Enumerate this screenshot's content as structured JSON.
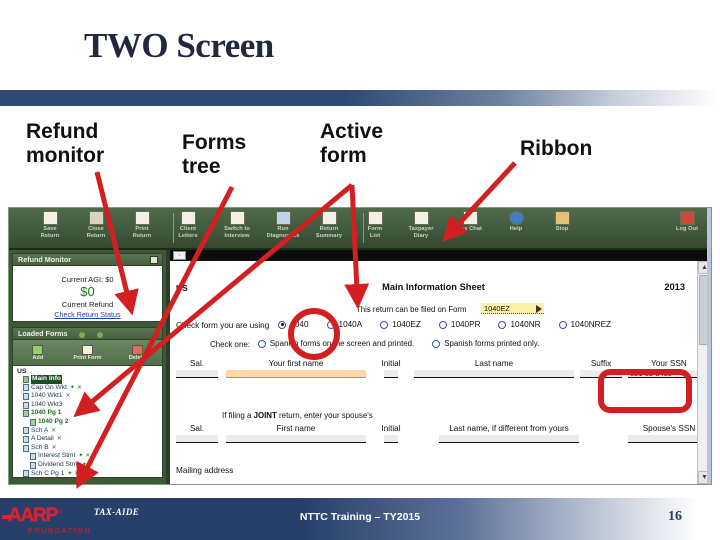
{
  "slide": {
    "title": "TWO Screen",
    "page_number": "16"
  },
  "callouts": [
    {
      "id": "refund-monitor",
      "label": "Refund\nmonitor"
    },
    {
      "id": "forms-tree",
      "label": "Forms\ntree"
    },
    {
      "id": "active-form",
      "label": "Active\nform"
    },
    {
      "id": "ribbon",
      "label": "Ribbon"
    }
  ],
  "callout_text": {
    "refund_monitor_l1": "Refund",
    "refund_monitor_l2": "monitor",
    "forms_tree_l1": "Forms",
    "forms_tree_l2": "tree",
    "active_form_l1": "Active",
    "active_form_l2": "form",
    "ribbon": "Ribbon"
  },
  "app": {
    "ribbon": {
      "items": [
        {
          "label_l1": "Save",
          "label_l2": "Return",
          "icon": "save-icon"
        },
        {
          "label_l1": "Close",
          "label_l2": "Return",
          "icon": "close-folder-icon"
        },
        {
          "label_l1": "Print",
          "label_l2": "Return",
          "icon": "printer-icon"
        },
        {
          "label_l1": "Client",
          "label_l2": "Letters",
          "icon": "envelope-icon"
        },
        {
          "label_l1": "Switch to",
          "label_l2": "Interview",
          "icon": "document-note-icon"
        },
        {
          "label_l1": "Run",
          "label_l2": "Diagnostics",
          "icon": "diagnostics-icon"
        },
        {
          "label_l1": "Return",
          "label_l2": "Summary",
          "icon": "summary-page-icon"
        },
        {
          "label_l1": "Form",
          "label_l2": "List",
          "icon": "list-icon"
        },
        {
          "label_l1": "Taxpayer",
          "label_l2": "Diary",
          "icon": "diary-icon"
        },
        {
          "label_l1": "Tax Chat",
          "label_l2": "",
          "icon": "chat-icon"
        },
        {
          "label_l1": "Help",
          "label_l2": "",
          "icon": "help-circle-icon"
        },
        {
          "label_l1": "Stop",
          "label_l2": "",
          "icon": "hourglass-icon"
        }
      ],
      "logout": {
        "label_l1": "Log Out",
        "icon": "logout-icon"
      }
    },
    "refund_monitor": {
      "header": "Refund Monitor",
      "current_agi": "Current AGI: $0",
      "amount": "$0",
      "caption": "Current Refund",
      "link": "Check Return Status"
    },
    "loaded_forms": {
      "header": "Loaded Forms",
      "buttons": [
        {
          "label": "Add",
          "icon": "add-icon"
        },
        {
          "label": "Print Form",
          "icon": "printer-icon"
        },
        {
          "label": "Delete",
          "icon": "delete-icon"
        }
      ]
    },
    "forms_tree": {
      "root": "US",
      "nodes": [
        {
          "label": "Main Info",
          "indent": 1,
          "state": "selected",
          "marks": ""
        },
        {
          "label": "Cap Gn Wkt",
          "indent": 1,
          "state": "normal",
          "marks": "✦ ✕"
        },
        {
          "label": "1040 Wkt1",
          "indent": 1,
          "state": "normal",
          "marks": "✕"
        },
        {
          "label": "1040 Wkt3",
          "indent": 1,
          "state": "normal",
          "marks": ""
        },
        {
          "label": "1040 Pg 1",
          "indent": 1,
          "state": "bold",
          "marks": ""
        },
        {
          "label": "1040 Pg 2",
          "indent": 2,
          "state": "bold",
          "marks": ""
        },
        {
          "label": "Sch A",
          "indent": 1,
          "state": "normal",
          "marks": "✕"
        },
        {
          "label": "A Detail",
          "indent": 1,
          "state": "normal",
          "marks": "✕"
        },
        {
          "label": "Sch B",
          "indent": 1,
          "state": "normal",
          "marks": "✕"
        },
        {
          "label": "Interest Stmt",
          "indent": 2,
          "state": "normal",
          "marks": "✦ ✕"
        },
        {
          "label": "Dividend Stmt",
          "indent": 2,
          "state": "normal",
          "marks": "✦ ✕"
        },
        {
          "label": "Sch C Pg 1",
          "indent": 1,
          "state": "normal",
          "marks": "✦ ✕"
        }
      ]
    },
    "form": {
      "state_code": "US",
      "title": "Main Information Sheet",
      "year": "2013",
      "filed_on_label": "This return can be filed on Form",
      "filed_on_value": "1040EZ",
      "check_form_label": "Check form you are using",
      "form_options": [
        {
          "label": "1040",
          "selected": true
        },
        {
          "label": "1040A",
          "selected": false
        },
        {
          "label": "1040EZ",
          "selected": false
        },
        {
          "label": "1040PR",
          "selected": false
        },
        {
          "label": "1040NR",
          "selected": false
        },
        {
          "label": "1040NREZ",
          "selected": false
        }
      ],
      "check_one_label": "Check one:",
      "spanish_options": [
        {
          "label": "Spanish forms on the screen and printed.",
          "selected": false
        },
        {
          "label": "Spanish forms printed only.",
          "selected": false
        }
      ],
      "taxpayer_row": {
        "sal": "Sal.",
        "first_name": "Your first name",
        "initial": "Initial",
        "last_name": "Last name",
        "suffix": "Suffix",
        "ssn_label": "Your SSN",
        "ssn_value": "021-02-8438"
      },
      "joint_note_pre": "If filing a",
      "joint_note_bold": "JOINT",
      "joint_note_post": "return, enter your spouse's",
      "spouse_row": {
        "sal": "Sal.",
        "first_name": "First name",
        "initial": "Initial",
        "last_name": "Last name, if different from yours",
        "ssn_label": "Spouse's SSN"
      },
      "mailing_address": "Mailing address"
    }
  },
  "footer": {
    "brand": "AARP",
    "brand_sub": "FOUNDATION",
    "program": "TAX-AIDE",
    "center_text": "NTTC Training – TY2015",
    "page": "16"
  },
  "colors": {
    "title_navy": "#20283c",
    "divider_navy": "#2e4a73",
    "annotation_red": "#d21f21",
    "ribbon_green": "#41593e",
    "refund_green": "#1f7a1f",
    "aarp_red": "#d62134",
    "footer_navy": "#27406a"
  }
}
